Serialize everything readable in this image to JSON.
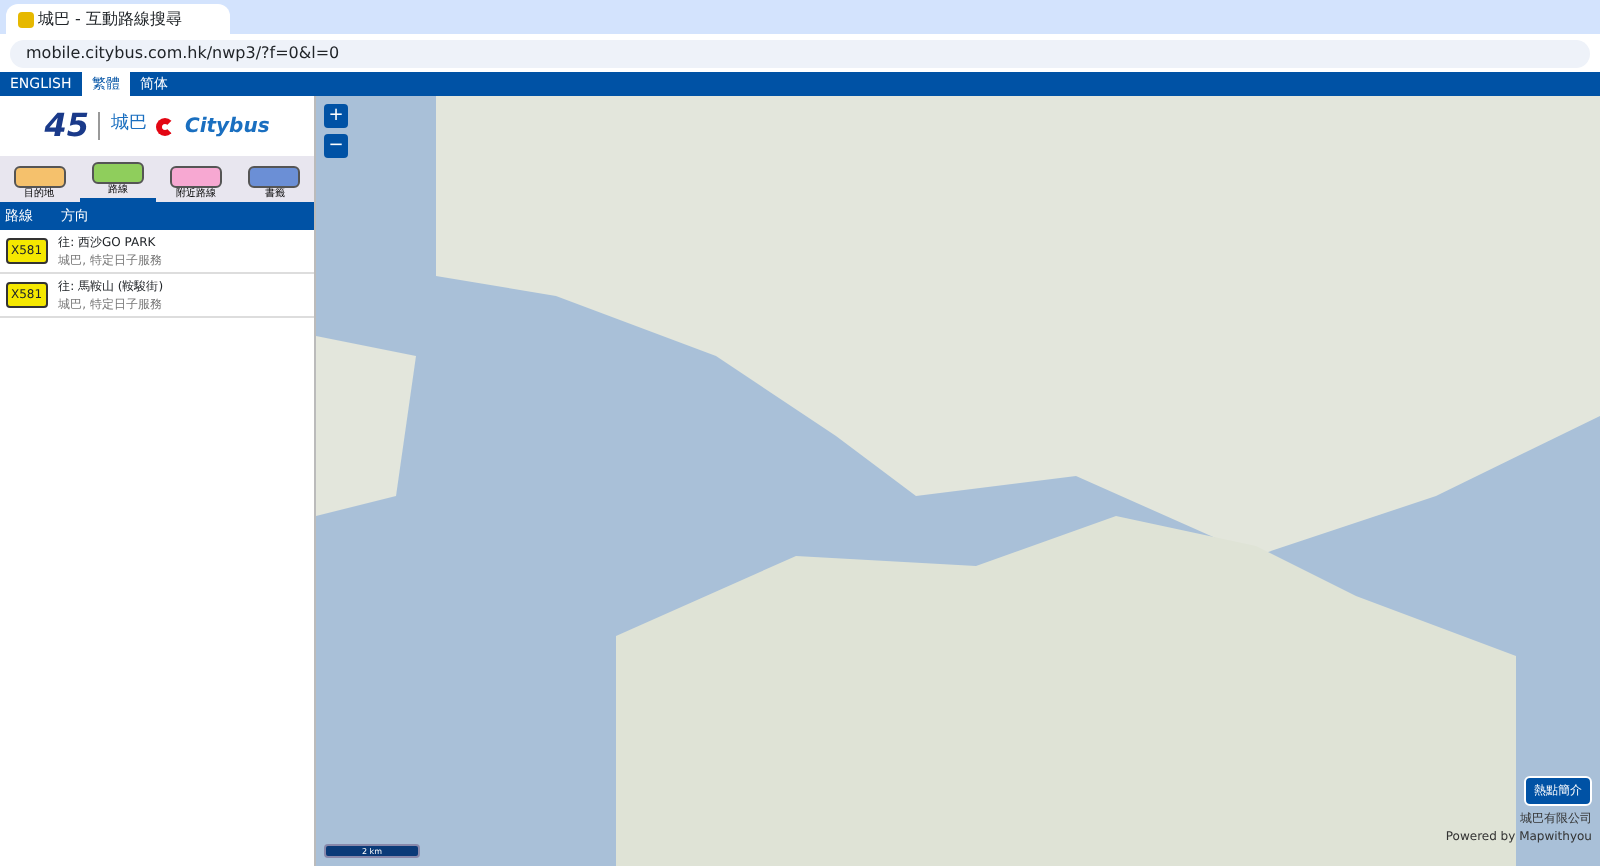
{
  "browser": {
    "tab_title": "城巴 - 互動路線搜尋",
    "url": "mobile.citybus.com.hk/nwp3/?f=0&l=0"
  },
  "languages": [
    {
      "label": "ENGLISH",
      "selected": false
    },
    {
      "label": "繁體",
      "selected": true
    },
    {
      "label": "简体",
      "selected": false
    }
  ],
  "logo": {
    "badge": "45",
    "brand_chinese": "城巴",
    "brand": "Citybus"
  },
  "modes": [
    {
      "label": "目的地",
      "selected": false
    },
    {
      "label": "路線",
      "selected": true
    },
    {
      "label": "附近路線",
      "selected": false
    },
    {
      "label": "書籤",
      "selected": false
    }
  ],
  "table": {
    "columns": [
      "路線",
      "方向"
    ],
    "rows": [
      {
        "route": "X581",
        "destination": "往: 西沙GO PARK",
        "operator": "城巴, 特定日子服務"
      },
      {
        "route": "X581",
        "destination": "往: 馬鞍山 (鞍駿街)",
        "operator": "城巴, 特定日子服務"
      }
    ]
  },
  "map": {
    "zoom_in": "+",
    "zoom_out": "−",
    "hotspot_button": "熱點簡介",
    "copyright": "城巴有限公司",
    "powered_by": "Powered by Mapwithyou",
    "scale": "2 km"
  }
}
